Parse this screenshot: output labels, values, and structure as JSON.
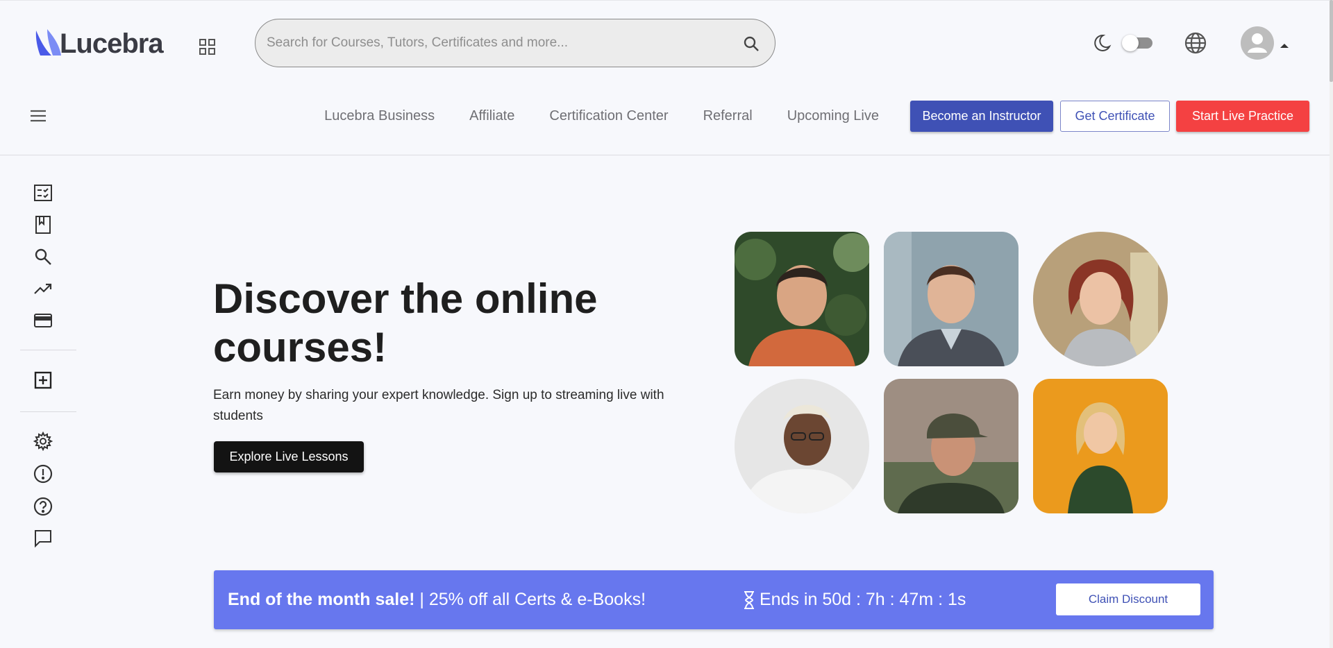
{
  "header": {
    "logo_text": "Lucebra",
    "search": {
      "placeholder": "Search for Courses, Tutors, Certificates and more...",
      "value": ""
    }
  },
  "nav": {
    "links": [
      "Lucebra Business",
      "Affiliate",
      "Certification Center",
      "Referral",
      "Upcoming Live"
    ],
    "become_instructor": "Become an Instructor",
    "get_certificate": "Get Certificate",
    "start_live_practice": "Start Live Practice"
  },
  "sidebar": {
    "icons": [
      "checklist-icon",
      "bookmark-book-icon",
      "search-icon",
      "trending-up-icon",
      "credit-card-icon",
      "add-box-icon",
      "settings-icon",
      "alert-circle-icon",
      "help-circle-icon",
      "chat-icon"
    ]
  },
  "hero": {
    "title": "Discover the online courses!",
    "subtitle": "Earn money by sharing your expert knowledge. Sign up to streaming live with students",
    "cta": "Explore Live Lessons"
  },
  "banner": {
    "headline": "End of the month sale!",
    "offer": " | 25% off all Certs & e-Books!",
    "timer": "Ends in 50d : 7h : 47m : 1s",
    "cta": "Claim Discount"
  },
  "colors": {
    "primary": "#3f51b5",
    "danger": "#f44142",
    "banner": "#6777ee",
    "logo_accent": "#5c6ff0"
  }
}
